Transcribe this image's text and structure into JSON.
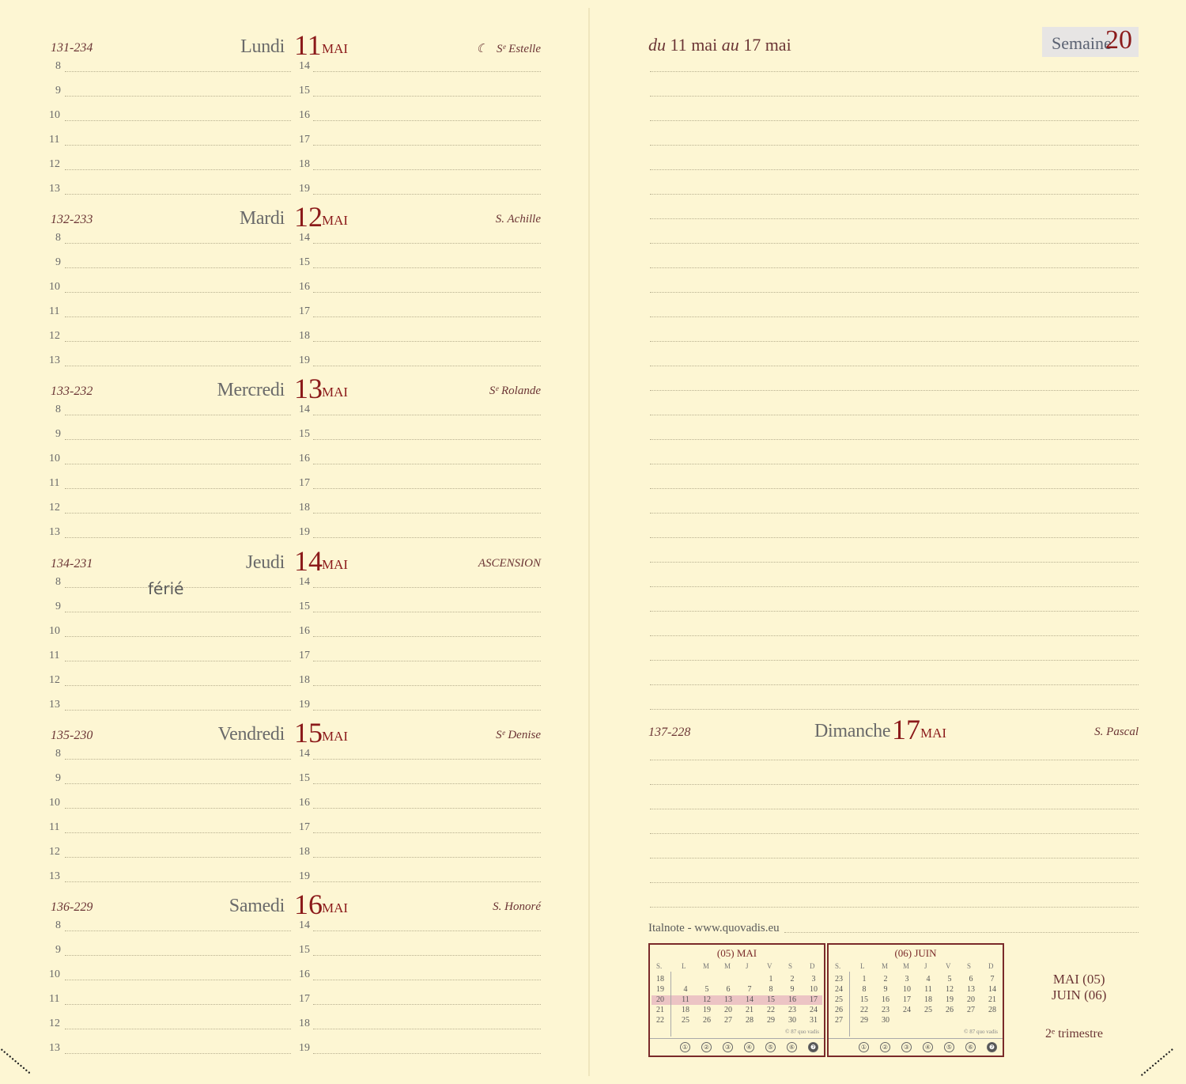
{
  "hours_left": [
    "8",
    "9",
    "10",
    "11",
    "12",
    "13"
  ],
  "hours_right": [
    "14",
    "15",
    "16",
    "17",
    "18",
    "19"
  ],
  "days": [
    {
      "doy": "131-234",
      "name": "Lundi",
      "num": "11",
      "month": "MAI",
      "saint": "Sᵉ Estelle",
      "moon": "☾"
    },
    {
      "doy": "132-233",
      "name": "Mardi",
      "num": "12",
      "month": "MAI",
      "saint": "S. Achille"
    },
    {
      "doy": "133-232",
      "name": "Mercredi",
      "num": "13",
      "month": "MAI",
      "saint": "Sᵉ Rolande"
    },
    {
      "doy": "134-231",
      "name": "Jeudi",
      "num": "14",
      "month": "MAI",
      "saint": "ASCENSION",
      "note": "férié"
    },
    {
      "doy": "135-230",
      "name": "Vendredi",
      "num": "15",
      "month": "MAI",
      "saint": "Sᵉ Denise"
    },
    {
      "doy": "136-229",
      "name": "Samedi",
      "num": "16",
      "month": "MAI",
      "saint": "S. Honoré"
    }
  ],
  "week": {
    "range_du": "du",
    "range_start": "11",
    "range_start_month": "mai",
    "range_au": "au",
    "range_end": "17",
    "range_end_month": "mai",
    "semaine_label": "Semaine",
    "semaine_num": "20"
  },
  "sunday": {
    "doy": "137-228",
    "name": "Dimanche",
    "num": "17",
    "month": "MAI",
    "saint": "S. Pascal"
  },
  "footer_brand": "Italnote - www.quovadis.eu",
  "mini_headers": [
    "S.",
    "L",
    "M",
    "M",
    "J",
    "V",
    "S",
    "D"
  ],
  "mini_cals": [
    {
      "title": "(05) MAI",
      "rows": [
        [
          "18",
          "",
          "",
          "",
          "",
          "1",
          "2",
          "3"
        ],
        [
          "19",
          "4",
          "5",
          "6",
          "7",
          "8",
          "9",
          "10"
        ],
        [
          "20",
          "11",
          "12",
          "13",
          "14",
          "15",
          "16",
          "17"
        ],
        [
          "21",
          "18",
          "19",
          "20",
          "21",
          "22",
          "23",
          "24"
        ],
        [
          "22",
          "25",
          "26",
          "27",
          "28",
          "29",
          "30",
          "31"
        ]
      ],
      "copy": "© 87 quo vadis"
    },
    {
      "title": "(06) JUIN",
      "rows": [
        [
          "23",
          "1",
          "2",
          "3",
          "4",
          "5",
          "6",
          "7"
        ],
        [
          "24",
          "8",
          "9",
          "10",
          "11",
          "12",
          "13",
          "14"
        ],
        [
          "25",
          "15",
          "16",
          "17",
          "18",
          "19",
          "20",
          "21"
        ],
        [
          "26",
          "22",
          "23",
          "24",
          "25",
          "26",
          "27",
          "28"
        ],
        [
          "27",
          "29",
          "30",
          "",
          "",
          "",
          "",
          ""
        ]
      ],
      "copy": "© 87 quo vadis"
    }
  ],
  "circles": [
    "①",
    "②",
    "③",
    "④",
    "⑤",
    "⑥",
    "❼"
  ],
  "side_months": [
    "MAI (05)",
    "JUIN (06)"
  ],
  "trimestre": "2ᵉ trimestre",
  "colors": {
    "paper": "#fdf6d3",
    "accent": "#8b1a1a",
    "highlight": "#ecc4c4",
    "semaine_box": "#e7e5e4"
  }
}
